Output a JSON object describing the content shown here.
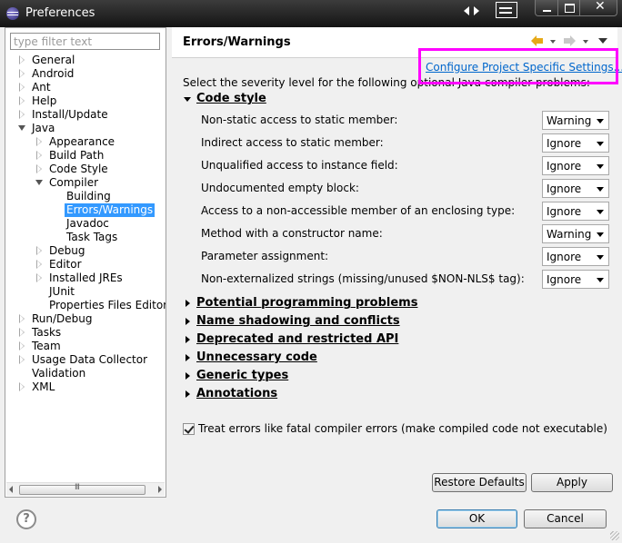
{
  "window": {
    "title": "Preferences"
  },
  "filter": {
    "placeholder": "type filter text"
  },
  "tree": {
    "general": "General",
    "android": "Android",
    "ant": "Ant",
    "help": "Help",
    "install_update": "Install/Update",
    "java": "Java",
    "appearance": "Appearance",
    "build_path": "Build Path",
    "code_style": "Code Style",
    "compiler": "Compiler",
    "building": "Building",
    "errors_warnings": "Errors/Warnings",
    "javadoc": "Javadoc",
    "task_tags": "Task Tags",
    "debug": "Debug",
    "editor": "Editor",
    "installed_jres": "Installed JREs",
    "junit": "JUnit",
    "properties_files_editor": "Properties Files Editor",
    "run_debug": "Run/Debug",
    "tasks": "Tasks",
    "team": "Team",
    "usage_data_collector": "Usage Data Collector",
    "validation": "Validation",
    "xml": "XML"
  },
  "page": {
    "title": "Errors/Warnings",
    "configure_link": "Configure Project Specific Settings...",
    "intro": "Select the severity level for the following optional Java compiler problems:"
  },
  "code_style": {
    "title": "Code style",
    "rows": [
      {
        "label": "Non-static access to static member:",
        "value": "Warning"
      },
      {
        "label": "Indirect access to static member:",
        "value": "Ignore"
      },
      {
        "label": "Unqualified access to instance field:",
        "value": "Ignore"
      },
      {
        "label": "Undocumented empty block:",
        "value": "Ignore"
      },
      {
        "label": "Access to a non-accessible member of an enclosing type:",
        "value": "Ignore"
      },
      {
        "label": "Method with a constructor name:",
        "value": "Warning"
      },
      {
        "label": "Parameter assignment:",
        "value": "Ignore"
      },
      {
        "label": "Non-externalized strings (missing/unused $NON-NLS$ tag):",
        "value": "Ignore"
      }
    ]
  },
  "sections": {
    "potential": "Potential programming problems",
    "shadowing": "Name shadowing and conflicts",
    "deprecated": "Deprecated and restricted API",
    "unnecessary": "Unnecessary code",
    "generic": "Generic types",
    "annotations": "Annotations"
  },
  "treat_errors": {
    "label": "Treat errors like fatal compiler errors (make compiled code not executable)",
    "checked": true
  },
  "buttons": {
    "restore": "Restore Defaults",
    "apply": "Apply",
    "ok": "OK",
    "cancel": "Cancel",
    "help": "?"
  },
  "colors": {
    "highlight": "#ff00ff",
    "link": "#0066cc",
    "selection": "#3399ff"
  }
}
